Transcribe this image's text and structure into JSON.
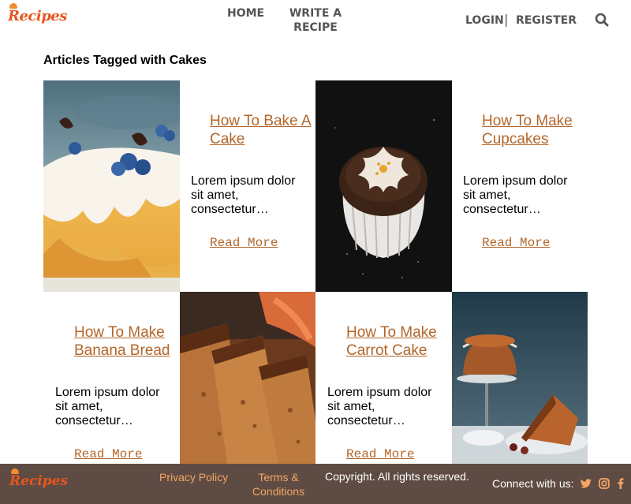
{
  "header": {
    "logo": "Recipes",
    "nav": {
      "home": "HOME",
      "write_recipe": "WRITE A RECIPE",
      "login": "LOGIN",
      "separator": "|",
      "register": "REGISTER"
    },
    "search_icon": "search-icon"
  },
  "page_title": "Articles Tagged with Cakes",
  "articles": [
    {
      "title": "How To Bake A Cake",
      "excerpt": "Lorem ipsum dolor sit amet, consectetur…",
      "read_more": "Read More",
      "image": "cake-with-blueberries-photo"
    },
    {
      "title": "How To Make Cupcakes",
      "excerpt": "Lorem ipsum dolor sit amet, consectetur…",
      "read_more": "Read More",
      "image": "chocolate-cupcake-photo"
    },
    {
      "title": "How To Make Banana Bread",
      "excerpt": "Lorem ipsum dolor sit amet, consectetur…",
      "read_more": "Read More",
      "image": "banana-bread-photo"
    },
    {
      "title": "How To Make Carrot Cake",
      "excerpt": "Lorem ipsum dolor sit amet, consectetur…",
      "read_more": "Read More",
      "image": "carrot-cake-photo"
    }
  ],
  "footer": {
    "logo": "Recipes",
    "privacy": "Privacy Policy",
    "terms": "Terms & Conditions",
    "copyright": "Copyright. All rights reserved.",
    "connect": "Connect with us:",
    "social_icons": [
      "twitter-icon",
      "instagram-icon",
      "facebook-icon"
    ]
  },
  "colors": {
    "accent": "#b3662a",
    "nav_text": "#555555",
    "footer_bg": "#5e4c44",
    "footer_link": "#f3a464",
    "logo": "#e8561f"
  }
}
